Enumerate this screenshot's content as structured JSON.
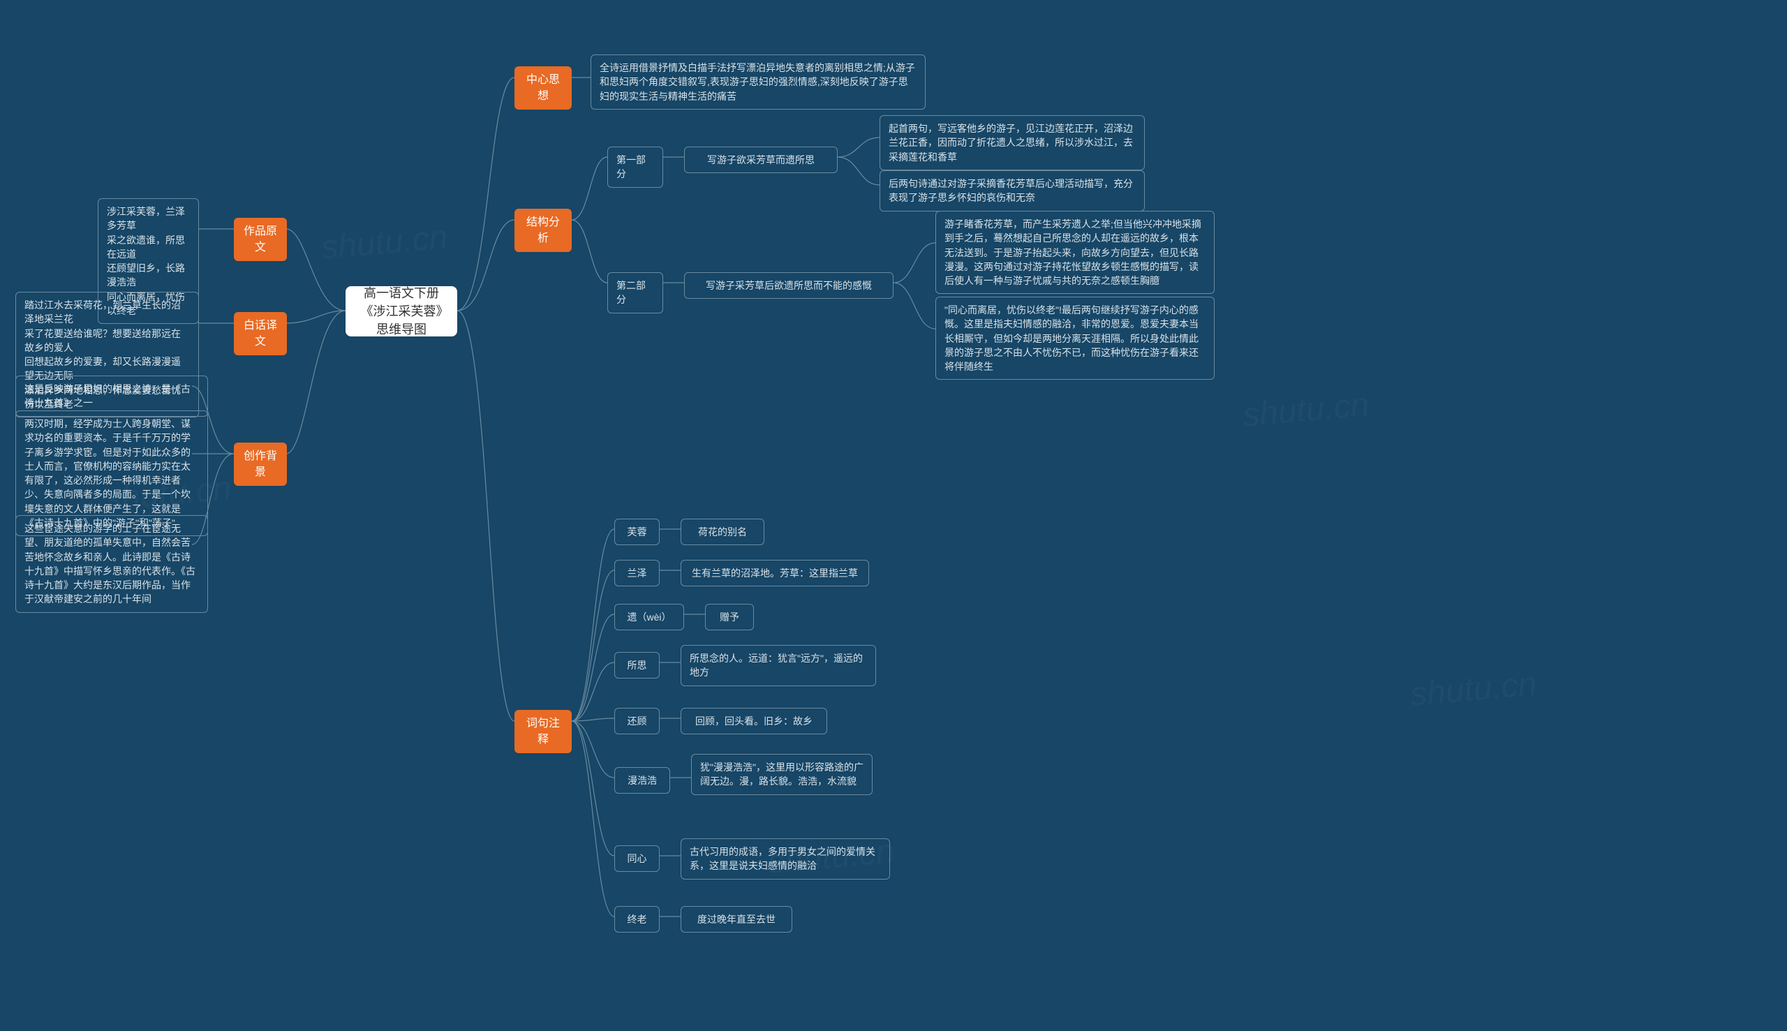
{
  "root": "高一语文下册《涉江采芙蓉》思维导图",
  "watermark": "shutu.cn",
  "left": {
    "yuanwen": {
      "label": "作品原文",
      "text": "涉江采芙蓉，兰泽多芳草\n采之欲遗谁，所思在远道\n还顾望旧乡，长路漫浩浩\n同心而离居，忧伤以终老"
    },
    "baihua": {
      "label": "白话译文",
      "text": "踏过江水去采荷花，到兰草生长的沼泽地采兰花\n采了花要送给谁呢？想要送给那远在故乡的爱人\n回想起故乡的爱妻，却又长路漫漫遥望无边无际\n漂泊异乡两地相思，怀念爱妻愁苦忧伤以至终老"
    },
    "beijing": {
      "label": "创作背景",
      "text1": "这是反映游子思妇的相思之诗，是《古诗十九首》之一",
      "text2": "两汉时期，经学成为士人跨身朝堂、谋求功名的重要资本。于是千千万万的学子离乡游学求宦。但是对于如此众多的士人而言，官僚机构的容纳能力实在太有限了，这必然形成一种得机幸进者少、失意向隅者多的局面。于是一个坎壈失意的文人群体便产生了，这就是《古诗十九首》中的\"游子\"和\"荡子\"",
      "text3": "这些宦途失意的游学的士子在宦途无望、朋友道绝的孤单失意中，自然会苦苦地怀念故乡和亲人。此诗即是《古诗十九首》中描写怀乡思亲的代表作。《古诗十九首》大约是东汉后期作品，当作于汉献帝建安之前的几十年间"
    }
  },
  "right": {
    "sixiang": {
      "label": "中心思想",
      "text": "全诗运用借景抒情及白描手法抒写漂泊异地失意者的离别相思之情;从游子和思妇两个角度交错叙写,表现游子思妇的强烈情感,深刻地反映了游子思妇的现实生活与精神生活的痛苦"
    },
    "jiegou": {
      "label": "结构分析",
      "part1": {
        "label": "第一部分",
        "desc": "写游子欲采芳草而遗所思",
        "t1": "起首两句，写远客他乡的游子，见江边莲花正开，沼泽边兰花正香，因而动了折花遗人之思绪，所以涉水过江，去采摘莲花和香草",
        "t2": "后两句诗通过对游子采摘香花芳草后心理活动描写，充分表现了游子思乡怀妇的哀伤和无奈"
      },
      "part2": {
        "label": "第二部分",
        "desc": "写游子采芳草后欲遗所思而不能的感慨",
        "t1": "游子睹香花芳草，而产生采芳遗人之举;但当他兴冲冲地采摘到手之后，蓦然想起自己所思念的人却在遥远的故乡，根本无法送到。于是游子抬起头来，向故乡方向望去，但见长路漫漫。这两句通过对游子持花怅望故乡顿生感慨的描写，读后使人有一种与游子忧戚与共的无奈之感顿生胸臆",
        "t2": "\"同心而离居，忧伤以终老\"!最后两句继续抒写游子内心的感慨。这里是指夫妇情感的融洽，非常的恩爱。恩爱夫妻本当长相厮守，但如今却是两地分离天涯相隔。所以身处此情此景的游子思之不由人不忧伤不已，而这种忧伤在游子看来还将伴随终生"
      }
    },
    "ciyu": {
      "label": "词句注释",
      "items": [
        {
          "term": "芙蓉",
          "def": "荷花的别名"
        },
        {
          "term": "兰泽",
          "def": "生有兰草的沼泽地。芳草：这里指兰草"
        },
        {
          "term": "遗（wèi）",
          "def": "赠予"
        },
        {
          "term": "所思",
          "def": "所思念的人。远道：犹言\"远方\"，遥远的地方"
        },
        {
          "term": "还顾",
          "def": "回顾，回头看。旧乡：故乡"
        },
        {
          "term": "漫浩浩",
          "def": "犹\"漫漫浩浩\"，这里用以形容路途的广阔无边。漫，路长貌。浩浩，水流貌"
        },
        {
          "term": "同心",
          "def": "古代习用的成语，多用于男女之间的爱情关系，这里是说夫妇感情的融洽"
        },
        {
          "term": "终老",
          "def": "度过晚年直至去世"
        }
      ]
    }
  }
}
